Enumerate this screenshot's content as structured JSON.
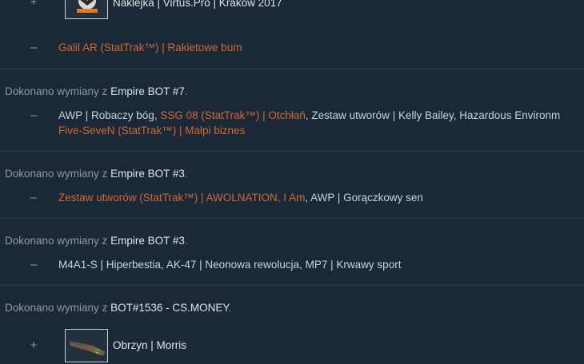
{
  "trades": [
    {
      "items": [
        {
          "sign": "+",
          "thumb": "vp-sticker-icon",
          "label": "Naklejka | Virtus.Pro | Kraków 2017"
        },
        {
          "sign": "–",
          "parts": [
            {
              "text": "Galil AR (StatTrak™) | Rakietowe bum",
              "color": "orange"
            }
          ]
        }
      ]
    },
    {
      "header_prefix": "Dokonano wymiany z ",
      "partner": "Empire BOT #7",
      "header_suffix": ".",
      "items": [
        {
          "sign": "–",
          "line1": [
            {
              "text": "AWP | Robaczy bóg, ",
              "color": "white"
            },
            {
              "text": "SSG 08 (StatTrak™) | Otchłań",
              "color": "orange"
            },
            {
              "text": ", Zestaw utworów | Kelly Bailey, Hazardous Environm",
              "color": "white"
            }
          ],
          "line2": [
            {
              "text": "Five-SeveN (StatTrak™) | Małpi biznes",
              "color": "orange"
            }
          ]
        }
      ]
    },
    {
      "header_prefix": "Dokonano wymiany z ",
      "partner": "Empire BOT #3",
      "header_suffix": ".",
      "items": [
        {
          "sign": "–",
          "line1": [
            {
              "text": "Zestaw utworów (StatTrak™) | AWOLNATION, I Am",
              "color": "orange"
            },
            {
              "text": ", AWP | Gorączkowy sen",
              "color": "white"
            }
          ]
        }
      ]
    },
    {
      "header_prefix": "Dokonano wymiany z ",
      "partner": "Empire BOT #3",
      "header_suffix": ".",
      "items": [
        {
          "sign": "–",
          "line1": [
            {
              "text": "M4A1-S | Hiperbestia, AK-47 | Neonowa rewolucja, MP7 | Krwawy sport",
              "color": "white"
            }
          ]
        }
      ]
    },
    {
      "header_prefix": "Dokonano wymiany z ",
      "partner": "BOT#1536 - CS.MONEY",
      "header_suffix": ".",
      "items": [
        {
          "sign": "+",
          "thumb": "sawed-off-gun-icon",
          "label": "Obrzyn | Morris"
        }
      ]
    }
  ],
  "colors": {
    "background": "#1b2838",
    "orange": "#cf6a32",
    "white": "#c6d4df",
    "muted": "#8f98a0"
  }
}
